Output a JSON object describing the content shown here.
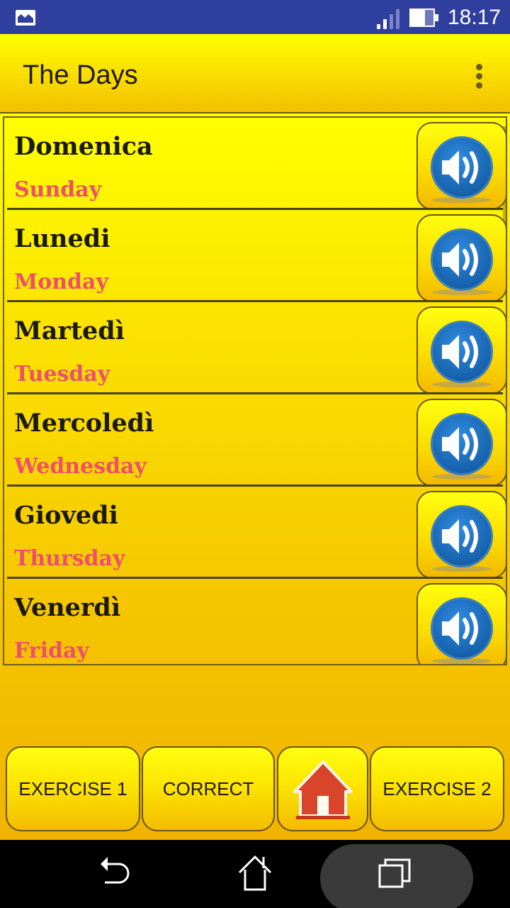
{
  "status_bar": {
    "notification_icon": "gallery-icon",
    "signal_icon": "signal-icon",
    "battery_icon": "battery-icon",
    "time": "18:17"
  },
  "app_bar": {
    "title": "The Days",
    "overflow_icon": "more-vert-icon"
  },
  "days": [
    {
      "italian": "Domenica",
      "english": "Sunday",
      "sound_icon": "speaker-icon"
    },
    {
      "italian": "Lunedi",
      "english": "Monday",
      "sound_icon": "speaker-icon"
    },
    {
      "italian": "Martedì",
      "english": "Tuesday",
      "sound_icon": "speaker-icon"
    },
    {
      "italian": "Mercoledì",
      "english": "Wednesday",
      "sound_icon": "speaker-icon"
    },
    {
      "italian": "Giovedi",
      "english": "Thursday",
      "sound_icon": "speaker-icon"
    },
    {
      "italian": "Venerdì",
      "english": "Friday",
      "sound_icon": "speaker-icon"
    }
  ],
  "bottom_bar": {
    "exercise1": "EXERCISE 1",
    "correct": "CORRECT",
    "home_icon": "home-icon",
    "exercise2": "EXERCISE 2"
  },
  "nav_bar": {
    "back_icon": "back-icon",
    "home_icon": "home-icon",
    "recents_icon": "recents-icon"
  },
  "colors": {
    "status_bar": "#2f3f9e",
    "italian_text": "#1a1a0e",
    "english_text": "#ee4f6a",
    "speaker_blue": "#1e6fbf",
    "home_red": "#d9452a"
  }
}
